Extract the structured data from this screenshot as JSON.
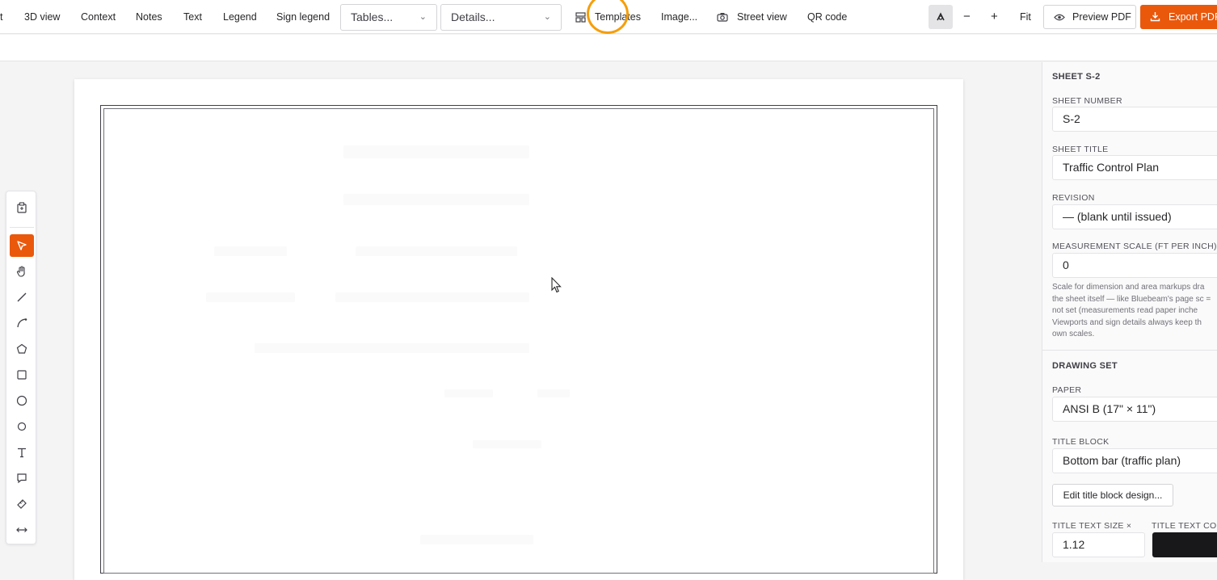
{
  "toolbar": {
    "items": [
      "t",
      "3D view",
      "Context",
      "Notes",
      "Text",
      "Legend",
      "Sign legend"
    ],
    "tables_select": "Tables...",
    "details_select": "Details...",
    "templates_label": "Templates",
    "image_label": "Image...",
    "street_view_label": "Street view",
    "qr_code_label": "QR code",
    "zoom_fit_label": "Fit",
    "preview_pdf_label": "Preview PDF",
    "export_pdf_label": "Export PDF",
    "accent_color": "#ea580c"
  },
  "tools": [
    "clipboard-icon",
    "select-arrow-icon",
    "hand-pan-icon",
    "line-icon",
    "arc-icon",
    "polygon-icon",
    "rectangle-icon",
    "circle-icon",
    "ellipse-icon",
    "text-icon",
    "callout-icon",
    "measure-icon",
    "dimension-icon"
  ],
  "panel": {
    "sheet_heading": "SHEET S-2",
    "sheet_number_label": "SHEET NUMBER",
    "sheet_number_value": "S-2",
    "sheet_title_label": "SHEET TITLE",
    "sheet_title_value": "Traffic Control Plan",
    "revision_label": "REVISION",
    "revision_value": "— (blank until issued)",
    "measurement_label": "MEASUREMENT SCALE (FT PER INCH)",
    "measurement_value": "0",
    "help_text": "Scale for dimension and area markups dra the sheet itself — like Bluebeam's page sc = not set (measurements read paper inche Viewports and sign details always keep th own scales.",
    "drawing_set_heading": "DRAWING SET",
    "paper_label": "PAPER",
    "paper_value": "ANSI B (17\" × 11\")",
    "title_block_label": "TITLE BLOCK",
    "title_block_value": "Bottom bar (traffic plan)",
    "edit_title_block_label": "Edit title block design...",
    "title_text_size_label": "TITLE TEXT SIZE ×",
    "title_text_size_value": "1.12",
    "title_text_color_label": "TITLE TEXT COL",
    "title_text_color": "#18181b"
  }
}
